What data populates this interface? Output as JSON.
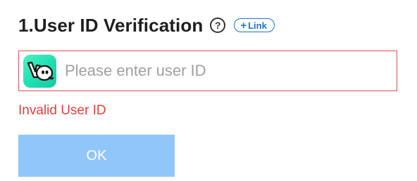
{
  "header": {
    "title": "1.User ID Verification",
    "help_icon": "?",
    "link_plus": "+",
    "link_label": "Link"
  },
  "input": {
    "app_icon": "app-logo-icon",
    "placeholder": "Please enter user ID",
    "value": "",
    "border_color": "#d9534f"
  },
  "error": {
    "message": "Invalid User ID",
    "color": "#e0413a"
  },
  "actions": {
    "ok_label": "OK",
    "ok_color": "#91c6fb"
  }
}
